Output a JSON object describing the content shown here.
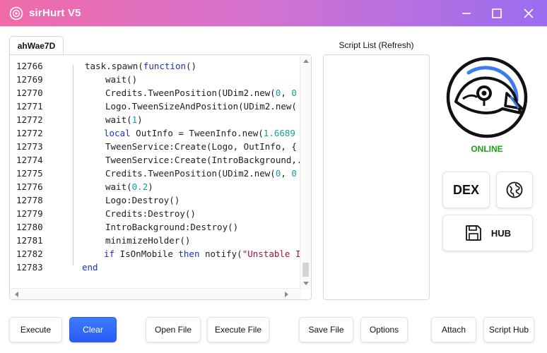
{
  "window": {
    "title": "sirHurt V5",
    "icons": {
      "app": "eye-swirl-icon",
      "minimize": "minimize-icon",
      "maximize": "maximize-icon",
      "close": "close-icon"
    }
  },
  "editor": {
    "tab_label": "ahWae7D",
    "lines": [
      {
        "ln": "12766",
        "indent": 1,
        "code": "task.spawn(function()"
      },
      {
        "ln": "12769",
        "indent": 2,
        "code": "wait()"
      },
      {
        "ln": "12770",
        "indent": 2,
        "code": "Credits.TweenPosition(UDim2.new(0, 0"
      },
      {
        "ln": "12771",
        "indent": 2,
        "code": "Logo.TweenSizeAndPosition(UDim2.new("
      },
      {
        "ln": "12772",
        "indent": 2,
        "code": "wait(1)"
      },
      {
        "ln": "12772",
        "indent": 2,
        "code": "local OutInfo = TweenInfo.new(1.6689"
      },
      {
        "ln": "12773",
        "indent": 2,
        "code": "TweenService:Create(Logo, OutInfo, {"
      },
      {
        "ln": "12774",
        "indent": 2,
        "code": "TweenService:Create(IntroBackground,."
      },
      {
        "ln": "12775",
        "indent": 2,
        "code": "Credits.TweenPosition(UDim2.new(0, 0"
      },
      {
        "ln": "12776",
        "indent": 2,
        "code": "wait(0.2)"
      },
      {
        "ln": "12778",
        "indent": 2,
        "code": "Logo:Destroy()"
      },
      {
        "ln": "12779",
        "indent": 2,
        "code": "Credits:Destroy()"
      },
      {
        "ln": "12780",
        "indent": 2,
        "code": "IntroBackground:Destroy()"
      },
      {
        "ln": "12781",
        "indent": 2,
        "code": "minimizeHolder()"
      },
      {
        "ln": "12782",
        "indent": 2,
        "code": "if IsOnMobile then notify(\"Unstable I"
      },
      {
        "ln": "12783",
        "indent": 0,
        "code": "end"
      }
    ]
  },
  "script_list": {
    "title": "Script List (Refresh)"
  },
  "status": {
    "label": "ONLINE",
    "color": "#1aa31a"
  },
  "side": {
    "dex_label": "DEX",
    "hub_label": "HUB",
    "icons": {
      "globe": "globe-icon",
      "save": "floppy-disk-icon",
      "logo": "bird-logo-icon"
    }
  },
  "buttons": {
    "execute": "Execute",
    "clear": "Clear",
    "open_file": "Open File",
    "execute_file": "Execute File",
    "save_file": "Save File",
    "options": "Options",
    "attach": "Attach",
    "script_hub": "Script Hub"
  },
  "colors": {
    "accent": "#2a5cf2",
    "titlebar_start": "#f06ba7",
    "titlebar_end": "#9a6df0",
    "keyword": "#1d2fbf",
    "number": "#10a0a0",
    "string": "#a01040"
  }
}
